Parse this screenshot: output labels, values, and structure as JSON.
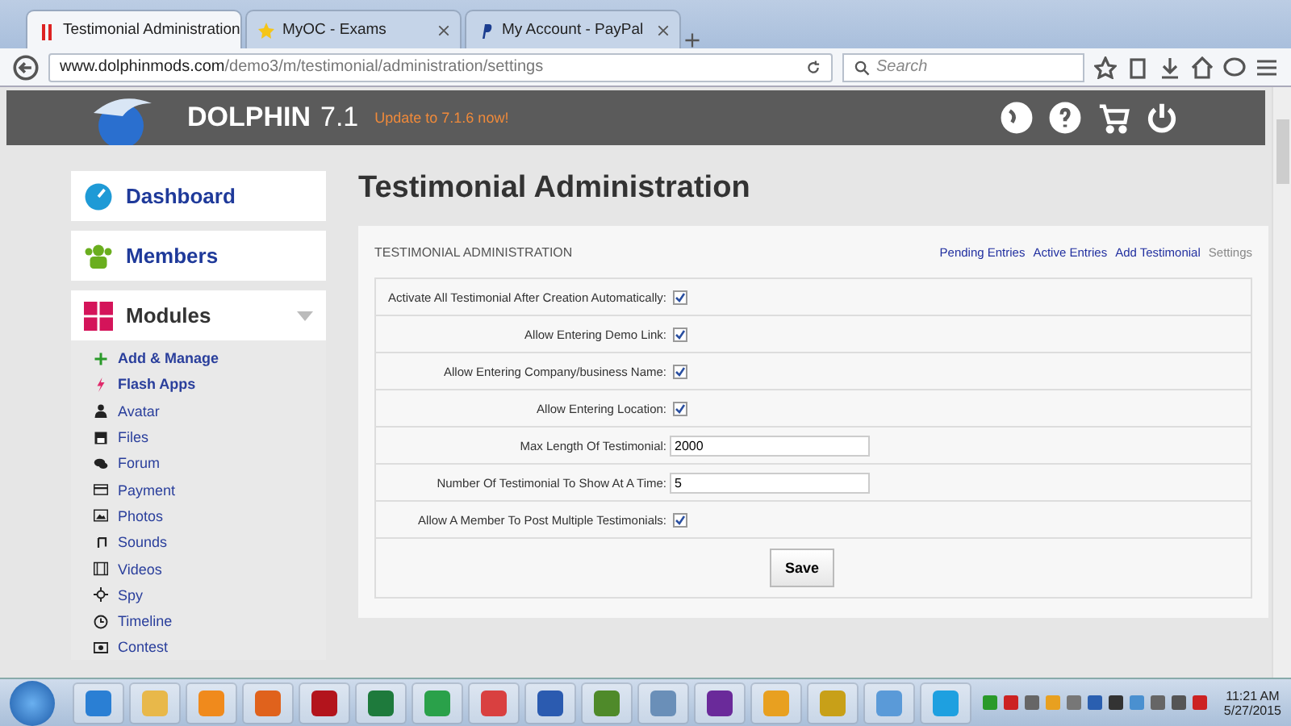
{
  "browser": {
    "tabs": [
      {
        "title": "Testimonial Administration",
        "selected": true
      },
      {
        "title": "MyOC - Exams",
        "selected": false
      },
      {
        "title": "My Account - PayPal",
        "selected": false
      }
    ],
    "url_host": "www.dolphinmods.com",
    "url_path": "/demo3/m/testimonial/administration/settings",
    "search": {
      "placeholder": "Search"
    }
  },
  "header": {
    "brand": "DOLPHIN",
    "version": "7.1",
    "update": "Update to 7.1.6 now!"
  },
  "sidebar": {
    "sections": [
      {
        "label": "Dashboard",
        "expanded": false
      },
      {
        "label": "Members",
        "expanded": false
      },
      {
        "label": "Modules",
        "expanded": true
      }
    ],
    "items": [
      {
        "label": "Add & Manage",
        "bold": true
      },
      {
        "label": "Flash Apps",
        "bold": true
      },
      {
        "label": "Avatar",
        "bold": false
      },
      {
        "label": "Files",
        "bold": false
      },
      {
        "label": "Forum",
        "bold": false
      },
      {
        "label": "Payment",
        "bold": false
      },
      {
        "label": "Photos",
        "bold": false
      },
      {
        "label": "Sounds",
        "bold": false
      },
      {
        "label": "Videos",
        "bold": false
      },
      {
        "label": "Spy",
        "bold": false
      },
      {
        "label": "Timeline",
        "bold": false
      },
      {
        "label": "Contest",
        "bold": false
      }
    ]
  },
  "page": {
    "title": "Testimonial Administration",
    "panel_title": "TESTIMONIAL ADMINISTRATION",
    "links": [
      {
        "label": "Pending Entries",
        "selected": false
      },
      {
        "label": "Active Entries",
        "selected": false
      },
      {
        "label": "Add Testimonial",
        "selected": false
      },
      {
        "label": "Settings",
        "selected": true
      }
    ],
    "settings": [
      {
        "kind": "checkbox",
        "label": "Activate All Testimonial After Creation Automatically:",
        "checked": true
      },
      {
        "kind": "checkbox",
        "label": "Allow Entering Demo Link:",
        "checked": true
      },
      {
        "kind": "checkbox",
        "label": "Allow Entering Company/business Name:",
        "checked": true
      },
      {
        "kind": "checkbox",
        "label": "Allow Entering Location:",
        "checked": true
      },
      {
        "kind": "text",
        "label": "Max Length Of Testimonial:",
        "value": "2000"
      },
      {
        "kind": "text",
        "label": "Number Of Testimonial To Show At A Time:",
        "value": "5"
      },
      {
        "kind": "checkbox",
        "label": "Allow A Member To Post Multiple Testimonials:",
        "checked": true
      }
    ],
    "save": "Save"
  },
  "taskbar": {
    "apps": [
      {
        "color": "#2a7fd4"
      },
      {
        "color": "#e8b84a"
      },
      {
        "color": "#f08a1c"
      },
      {
        "color": "#e0621c"
      },
      {
        "color": "#b3141c"
      },
      {
        "color": "#1e7a3c"
      },
      {
        "color": "#2aa14a"
      },
      {
        "color": "#d94040"
      },
      {
        "color": "#2b5bb0"
      },
      {
        "color": "#4f8a2a"
      },
      {
        "color": "#6a8fb8"
      },
      {
        "color": "#6a2a9a"
      },
      {
        "color": "#e8a020"
      },
      {
        "color": "#c8a018"
      },
      {
        "color": "#5a9ad8"
      },
      {
        "color": "#1ea0e0"
      }
    ],
    "time": "11:21 AM",
    "date": "5/27/2015"
  }
}
